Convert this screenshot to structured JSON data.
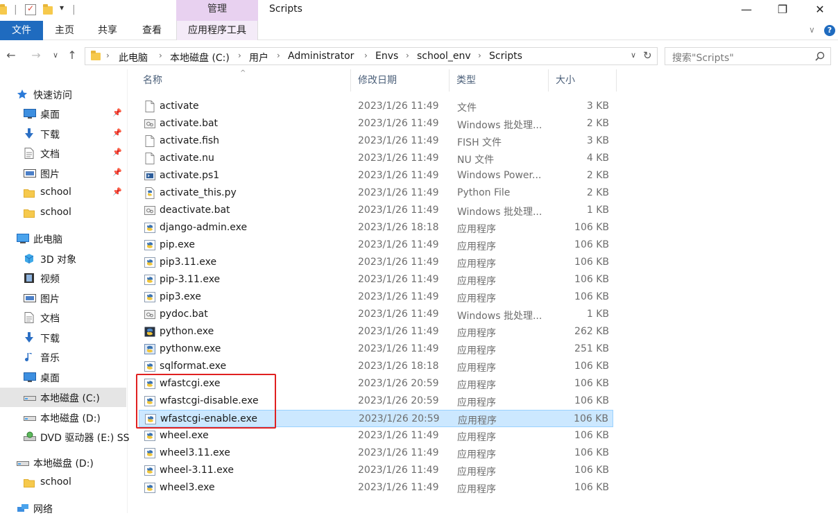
{
  "window": {
    "title": "Scripts",
    "context_tab": "管理",
    "controls": {
      "minimize": "—",
      "maximize": "❐",
      "close": "✕"
    }
  },
  "ribbon": {
    "tabs": [
      "文件",
      "主页",
      "共享",
      "查看",
      "应用程序工具"
    ]
  },
  "address": {
    "crumbs": [
      "此电脑",
      "本地磁盘 (C:)",
      "用户",
      "Administrator",
      "Envs",
      "school_env",
      "Scripts"
    ],
    "search_placeholder": "搜索\"Scripts\""
  },
  "nav": {
    "items": [
      {
        "label": "快速访问",
        "icon": "star-icon"
      },
      {
        "label": "桌面",
        "icon": "desktop-icon",
        "pinned": true
      },
      {
        "label": "下载",
        "icon": "download-icon",
        "pinned": true
      },
      {
        "label": "文档",
        "icon": "document-icon",
        "pinned": true
      },
      {
        "label": "图片",
        "icon": "picture-icon",
        "pinned": true
      },
      {
        "label": "school",
        "icon": "folder-icon",
        "pinned": true
      },
      {
        "label": "school",
        "icon": "folder-icon"
      },
      {
        "label": "此电脑",
        "icon": "computer-icon"
      },
      {
        "label": "3D 对象",
        "icon": "cube-icon"
      },
      {
        "label": "视频",
        "icon": "video-icon"
      },
      {
        "label": "图片",
        "icon": "picture-icon"
      },
      {
        "label": "文档",
        "icon": "document-icon"
      },
      {
        "label": "下载",
        "icon": "download-icon"
      },
      {
        "label": "音乐",
        "icon": "music-icon"
      },
      {
        "label": "桌面",
        "icon": "desktop-icon"
      },
      {
        "label": "本地磁盘 (C:)",
        "icon": "drive-icon",
        "selected": true
      },
      {
        "label": "本地磁盘 (D:)",
        "icon": "drive-icon"
      },
      {
        "label": "DVD 驱动器 (E:) SS",
        "icon": "dvd-icon"
      },
      {
        "label": "本地磁盘 (D:)",
        "icon": "drive-icon"
      },
      {
        "label": "school",
        "icon": "folder-icon"
      },
      {
        "label": "网络",
        "icon": "network-icon"
      }
    ]
  },
  "columns": {
    "name": "名称",
    "date": "修改日期",
    "type": "类型",
    "size": "大小"
  },
  "files": [
    {
      "name": "activate",
      "date": "2023/1/26 11:49",
      "type": "文件",
      "size": "3 KB",
      "icon": "file"
    },
    {
      "name": "activate.bat",
      "date": "2023/1/26 11:49",
      "type": "Windows 批处理...",
      "size": "2 KB",
      "icon": "bat"
    },
    {
      "name": "activate.fish",
      "date": "2023/1/26 11:49",
      "type": "FISH 文件",
      "size": "3 KB",
      "icon": "file"
    },
    {
      "name": "activate.nu",
      "date": "2023/1/26 11:49",
      "type": "NU 文件",
      "size": "4 KB",
      "icon": "file"
    },
    {
      "name": "activate.ps1",
      "date": "2023/1/26 11:49",
      "type": "Windows Power...",
      "size": "2 KB",
      "icon": "ps1"
    },
    {
      "name": "activate_this.py",
      "date": "2023/1/26 11:49",
      "type": "Python File",
      "size": "2 KB",
      "icon": "py"
    },
    {
      "name": "deactivate.bat",
      "date": "2023/1/26 11:49",
      "type": "Windows 批处理...",
      "size": "1 KB",
      "icon": "bat"
    },
    {
      "name": "django-admin.exe",
      "date": "2023/1/26 18:18",
      "type": "应用程序",
      "size": "106 KB",
      "icon": "exe"
    },
    {
      "name": "pip.exe",
      "date": "2023/1/26 11:49",
      "type": "应用程序",
      "size": "106 KB",
      "icon": "exe"
    },
    {
      "name": "pip3.11.exe",
      "date": "2023/1/26 11:49",
      "type": "应用程序",
      "size": "106 KB",
      "icon": "exe"
    },
    {
      "name": "pip-3.11.exe",
      "date": "2023/1/26 11:49",
      "type": "应用程序",
      "size": "106 KB",
      "icon": "exe"
    },
    {
      "name": "pip3.exe",
      "date": "2023/1/26 11:49",
      "type": "应用程序",
      "size": "106 KB",
      "icon": "exe"
    },
    {
      "name": "pydoc.bat",
      "date": "2023/1/26 11:49",
      "type": "Windows 批处理...",
      "size": "1 KB",
      "icon": "bat"
    },
    {
      "name": "python.exe",
      "date": "2023/1/26 11:49",
      "type": "应用程序",
      "size": "262 KB",
      "icon": "python"
    },
    {
      "name": "pythonw.exe",
      "date": "2023/1/26 11:49",
      "type": "应用程序",
      "size": "251 KB",
      "icon": "pythonw"
    },
    {
      "name": "sqlformat.exe",
      "date": "2023/1/26 18:18",
      "type": "应用程序",
      "size": "106 KB",
      "icon": "exe"
    },
    {
      "name": "wfastcgi.exe",
      "date": "2023/1/26 20:59",
      "type": "应用程序",
      "size": "106 KB",
      "icon": "exe"
    },
    {
      "name": "wfastcgi-disable.exe",
      "date": "2023/1/26 20:59",
      "type": "应用程序",
      "size": "106 KB",
      "icon": "exe"
    },
    {
      "name": "wfastcgi-enable.exe",
      "date": "2023/1/26 20:59",
      "type": "应用程序",
      "size": "106 KB",
      "icon": "exe",
      "selected": true
    },
    {
      "name": "wheel.exe",
      "date": "2023/1/26 11:49",
      "type": "应用程序",
      "size": "106 KB",
      "icon": "exe"
    },
    {
      "name": "wheel3.11.exe",
      "date": "2023/1/26 11:49",
      "type": "应用程序",
      "size": "106 KB",
      "icon": "exe"
    },
    {
      "name": "wheel-3.11.exe",
      "date": "2023/1/26 11:49",
      "type": "应用程序",
      "size": "106 KB",
      "icon": "exe"
    },
    {
      "name": "wheel3.exe",
      "date": "2023/1/26 11:49",
      "type": "应用程序",
      "size": "106 KB",
      "icon": "exe"
    }
  ],
  "colors": {
    "accent": "#1f6bbf",
    "selection": "#cce8ff",
    "highlight": "#e02020",
    "manage_tab": "#e8d1f0"
  }
}
